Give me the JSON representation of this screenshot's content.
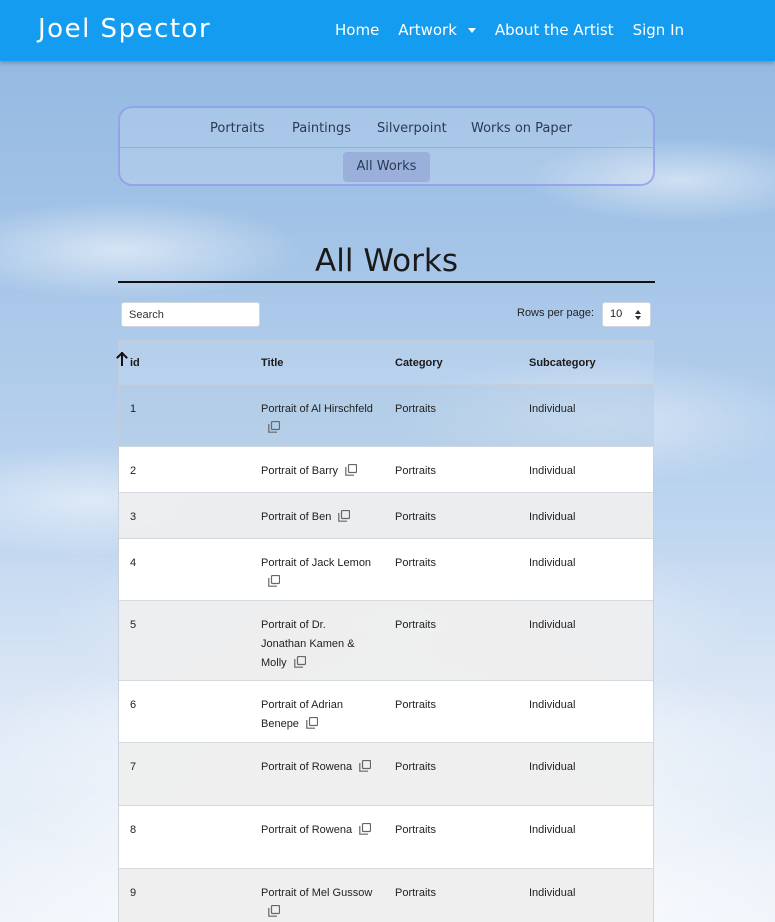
{
  "navbar": {
    "brand": "Joel Spector",
    "links": [
      {
        "label": "Home"
      },
      {
        "label": "Artwork"
      },
      {
        "label": "About the Artist"
      },
      {
        "label": "Sign In"
      }
    ]
  },
  "category_tabs": {
    "row1": [
      "Portraits",
      "Paintings",
      "Silverpoint",
      "Works on Paper"
    ],
    "active": "All Works"
  },
  "page_title": "All Works",
  "controls": {
    "search_placeholder": "Search",
    "rows_label": "Rows per page:",
    "rows_value": "10"
  },
  "table": {
    "columns": [
      "id",
      "Title",
      "Category",
      "Subcategory"
    ],
    "sort_column": "id",
    "sort_direction": "ascending",
    "rows": [
      {
        "id": "1",
        "title": "Portrait of Al Hirschfeld",
        "category": "Portraits",
        "subcategory": "Individual"
      },
      {
        "id": "2",
        "title": "Portrait of Barry",
        "category": "Portraits",
        "subcategory": "Individual"
      },
      {
        "id": "3",
        "title": "Portrait of Ben",
        "category": "Portraits",
        "subcategory": "Individual"
      },
      {
        "id": "4",
        "title": "Portrait of Jack Lemon",
        "category": "Portraits",
        "subcategory": "Individual"
      },
      {
        "id": "5",
        "title": "Portrait of Dr. Jonathan Kamen & Molly",
        "category": "Portraits",
        "subcategory": "Individual"
      },
      {
        "id": "6",
        "title": "Portrait of Adrian Benepe",
        "category": "Portraits",
        "subcategory": "Individual"
      },
      {
        "id": "7",
        "title": "Portrait of Rowena",
        "category": "Portraits",
        "subcategory": "Individual"
      },
      {
        "id": "8",
        "title": "Portrait of Rowena",
        "category": "Portraits",
        "subcategory": "Individual"
      },
      {
        "id": "9",
        "title": "Portrait of Mel Gussow",
        "category": "Portraits",
        "subcategory": "Individual"
      }
    ]
  },
  "icons": {
    "copy": "copy-icon",
    "sort": "arrow-up-icon",
    "dropdown": "caret-down-icon"
  },
  "colors": {
    "navbar": "#139cf0",
    "tab_border": "#8c96eb",
    "active_tab": "#96aad7"
  }
}
